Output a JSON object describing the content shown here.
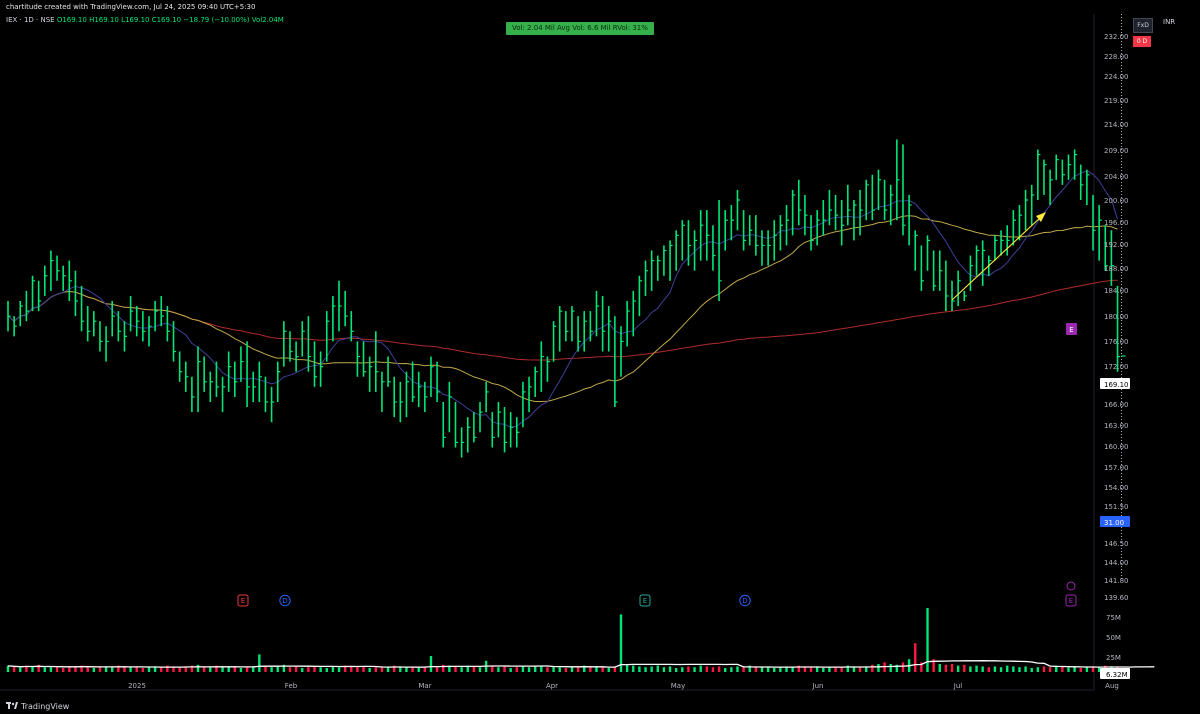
{
  "header": {
    "credit": "chartitude created with TradingView.com, Jul 24, 2025 09:40 UTC+5:30"
  },
  "legend": {
    "symbol": "IEX · 1D · NSE",
    "open": "O169.10",
    "high": "H169.10",
    "low": "L169.10",
    "close": "C169.10",
    "change": "−18.79 (−10.00%)",
    "vol": "Vol2.04M"
  },
  "vol_box": "Vol: 2.04 Mil  Avg Vol: 6.6 Mil  RVol: 31%",
  "toolbar": {
    "fx": "FxD",
    "dd": "0 D",
    "currency": "INR"
  },
  "branding": "TradingView",
  "colors": {
    "candle": "#00e676",
    "ma_fast": "#3f3f99",
    "ma_mid": "#bfa84a",
    "ma_slow": "#b02a2a",
    "vol_up": "#00e676",
    "vol_down": "#ff1744",
    "price_label": "#26a69a",
    "last_price_bg": "#ffffff"
  },
  "chart_data": {
    "type": "ohlc",
    "price_axis": {
      "ticks": [
        "232.00",
        "228.00",
        "224.00",
        "219.00",
        "214.00",
        "209.00",
        "204.00",
        "200.00",
        "196.00",
        "192.00",
        "188.00",
        "184.00",
        "180.00",
        "176.00",
        "172.00",
        "169.10",
        "166.00",
        "163.00",
        "160.00",
        "157.00",
        "154.00",
        "151.50",
        "31.00",
        "146.50",
        "144.00",
        "141.80",
        "139.60"
      ],
      "last_price": "169.10",
      "extra_label": "31.00"
    },
    "volume_axis": {
      "ticks": [
        "75M",
        "50M",
        "25M",
        "6.32M"
      ]
    },
    "time_axis": {
      "labels": [
        "2025",
        "Feb",
        "Mar",
        "Apr",
        "May",
        "Jun",
        "Jul",
        "Aug"
      ]
    },
    "events": [
      {
        "label": "E",
        "kind": "earnings",
        "color": "#f23645"
      },
      {
        "label": "D",
        "kind": "dividend",
        "color": "#2962ff"
      },
      {
        "label": "E",
        "kind": "earnings",
        "color": "#26a69a"
      },
      {
        "label": "D",
        "kind": "dividend",
        "color": "#2962ff"
      },
      {
        "label": "E",
        "kind": "earnings",
        "color": "#9c27b0"
      }
    ],
    "highs": [
      180,
      177,
      180,
      182,
      185,
      184,
      187,
      190,
      189,
      187,
      188,
      186,
      183,
      179,
      178,
      176,
      175,
      180,
      178,
      176,
      181,
      179,
      178,
      177,
      180,
      181,
      179,
      176,
      170,
      168,
      165,
      171,
      169,
      166,
      168,
      165,
      170,
      168,
      171,
      172,
      166,
      168,
      165,
      163,
      168,
      176,
      174,
      172,
      176,
      177,
      172,
      170,
      178,
      181,
      184,
      182,
      178,
      172,
      172,
      169,
      174,
      166,
      169,
      165,
      164,
      166,
      168,
      166,
      164,
      169,
      168,
      160,
      164,
      160,
      155,
      157,
      158,
      160,
      164,
      158,
      160,
      159,
      158,
      157,
      164,
      165,
      167,
      172,
      169,
      176,
      179,
      178,
      179,
      177,
      178,
      178,
      182,
      181,
      179,
      177,
      175,
      180,
      182,
      185,
      188,
      190,
      189,
      191,
      192,
      194,
      196,
      196,
      194,
      198,
      198,
      195,
      200,
      198,
      199,
      202,
      198,
      197,
      197,
      194,
      194,
      196,
      197,
      199,
      202,
      204,
      201,
      197,
      198,
      200,
      202,
      201,
      200,
      203,
      200,
      202,
      204,
      205,
      206,
      204,
      203,
      212,
      211,
      201,
      194,
      191,
      193,
      190,
      190,
      188,
      184,
      186,
      182,
      189,
      191,
      192,
      189,
      193,
      194,
      195,
      198,
      199,
      202,
      203,
      210,
      208,
      206,
      209,
      208,
      209,
      210,
      207,
      206,
      201,
      199,
      195,
      194,
      183
    ],
    "lows": [
      174,
      173,
      175,
      176,
      178,
      178,
      181,
      182,
      184,
      182,
      180,
      177,
      174,
      172,
      173,
      170,
      168,
      173,
      172,
      170,
      174,
      173,
      172,
      171,
      174,
      175,
      172,
      168,
      164,
      162,
      158,
      158,
      162,
      160,
      161,
      158,
      162,
      161,
      164,
      159,
      160,
      160,
      158,
      156,
      160,
      167,
      168,
      166,
      169,
      166,
      163,
      163,
      168,
      172,
      174,
      175,
      172,
      165,
      165,
      162,
      162,
      158,
      163,
      157,
      156,
      157,
      160,
      159,
      158,
      161,
      160,
      151,
      154,
      151,
      149,
      150,
      152,
      154,
      158,
      151,
      153,
      150,
      151,
      151,
      155,
      158,
      161,
      162,
      164,
      168,
      170,
      172,
      172,
      170,
      170,
      172,
      173,
      170,
      170,
      159,
      165,
      171,
      173,
      177,
      181,
      182,
      184,
      185,
      184,
      186,
      188,
      187,
      186,
      188,
      188,
      186,
      180,
      190,
      192,
      194,
      190,
      191,
      189,
      187,
      187,
      188,
      190,
      191,
      193,
      195,
      193,
      190,
      191,
      193,
      195,
      194,
      191,
      195,
      192,
      193,
      196,
      196,
      198,
      196,
      195,
      196,
      193,
      191,
      186,
      182,
      186,
      182,
      182,
      178,
      178,
      179,
      180,
      182,
      185,
      183,
      185,
      188,
      189,
      189,
      191,
      192,
      194,
      195,
      200,
      201,
      199,
      204,
      203,
      204,
      204,
      200,
      199,
      190,
      188,
      186,
      183,
      166
    ],
    "closes": [
      177,
      175,
      179,
      178,
      184,
      180,
      185,
      188,
      186,
      185,
      184,
      180,
      176,
      174,
      176,
      172,
      172,
      177,
      174,
      173,
      178,
      176,
      174,
      175,
      178,
      177,
      174,
      170,
      166,
      165,
      161,
      168,
      164,
      164,
      163,
      163,
      167,
      164,
      168,
      163,
      163,
      165,
      160,
      160,
      166,
      174,
      170,
      169,
      174,
      169,
      165,
      167,
      176,
      179,
      179,
      177,
      174,
      169,
      166,
      167,
      166,
      164,
      164,
      160,
      160,
      164,
      161,
      163,
      161,
      167,
      162,
      153,
      161,
      152,
      152,
      155,
      153,
      158,
      162,
      153,
      158,
      152,
      155,
      154,
      162,
      163,
      166,
      169,
      168,
      175,
      178,
      174,
      178,
      172,
      176,
      174,
      179,
      174,
      176,
      160,
      172,
      178,
      180,
      184,
      186,
      188,
      188,
      190,
      191,
      193,
      195,
      191,
      192,
      195,
      193,
      189,
      184,
      196,
      196,
      200,
      192,
      194,
      191,
      191,
      191,
      193,
      195,
      196,
      201,
      198,
      197,
      192,
      196,
      196,
      198,
      197,
      195,
      198,
      199,
      198,
      203,
      198,
      204,
      198,
      201,
      204,
      195,
      199,
      193,
      184,
      192,
      183,
      186,
      181,
      180,
      184,
      181,
      187,
      190,
      190,
      188,
      192,
      192,
      192,
      196,
      197,
      200,
      201,
      209,
      207,
      204,
      208,
      205,
      207,
      209,
      203,
      205,
      194,
      196,
      187,
      187,
      169
    ],
    "volume_ratio": [
      0.08,
      0.07,
      0.06,
      0.08,
      0.07,
      0.09,
      0.06,
      0.07,
      0.06,
      0.05,
      0.06,
      0.07,
      0.08,
      0.07,
      0.05,
      0.06,
      0.07,
      0.06,
      0.08,
      0.07,
      0.06,
      0.07,
      0.05,
      0.06,
      0.07,
      0.06,
      0.08,
      0.07,
      0.06,
      0.07,
      0.08,
      0.09,
      0.06,
      0.07,
      0.08,
      0.07,
      0.06,
      0.07,
      0.05,
      0.06,
      0.07,
      0.22,
      0.08,
      0.06,
      0.07,
      0.09,
      0.06,
      0.07,
      0.05,
      0.06,
      0.07,
      0.06,
      0.05,
      0.07,
      0.06,
      0.08,
      0.07,
      0.06,
      0.07,
      0.05,
      0.06,
      0.07,
      0.06,
      0.08,
      0.07,
      0.06,
      0.07,
      0.05,
      0.06,
      0.2,
      0.07,
      0.09,
      0.08,
      0.07,
      0.06,
      0.08,
      0.07,
      0.06,
      0.14,
      0.07,
      0.06,
      0.07,
      0.05,
      0.06,
      0.07,
      0.06,
      0.08,
      0.07,
      0.06,
      0.07,
      0.06,
      0.05,
      0.07,
      0.06,
      0.08,
      0.07,
      0.06,
      0.07,
      0.05,
      0.06,
      0.72,
      0.09,
      0.08,
      0.07,
      0.06,
      0.07,
      0.08,
      0.06,
      0.07,
      0.05,
      0.06,
      0.07,
      0.06,
      0.08,
      0.07,
      0.06,
      0.07,
      0.05,
      0.06,
      0.07,
      0.06,
      0.08,
      0.07,
      0.06,
      0.07,
      0.05,
      0.06,
      0.07,
      0.06,
      0.08,
      0.07,
      0.06,
      0.07,
      0.05,
      0.06,
      0.07,
      0.06,
      0.08,
      0.07,
      0.06,
      0.07,
      0.09,
      0.1,
      0.12,
      0.1,
      0.09,
      0.12,
      0.16,
      0.36,
      0.12,
      0.8,
      0.16,
      0.1,
      0.09,
      0.1,
      0.08,
      0.09,
      0.07,
      0.08,
      0.07,
      0.06,
      0.07,
      0.06,
      0.08,
      0.07,
      0.06,
      0.07,
      0.05,
      0.06,
      0.07,
      0.06,
      0.08,
      0.07,
      0.06,
      0.07,
      0.05,
      0.06,
      0.07,
      0.06,
      0.08,
      0.07,
      0.06,
      0.07,
      0.05,
      0.12,
      0.07,
      0.06,
      0.07
    ]
  }
}
